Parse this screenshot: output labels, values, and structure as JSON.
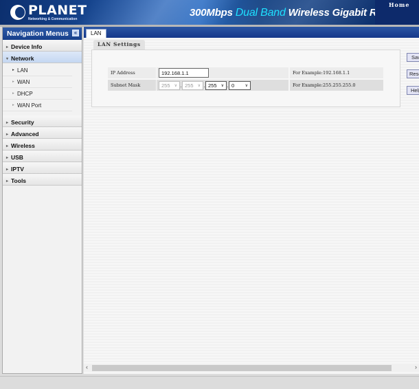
{
  "header": {
    "brand": "PLANET",
    "brand_tagline": "Networking & Communication",
    "product_prefix": "300Mbps ",
    "product_highlight": "Dual Band",
    "product_suffix": " Wireless Gigabit Route",
    "home_link": "Home"
  },
  "nav": {
    "title": "Navigation Menus",
    "collapse_icon": "«",
    "items": [
      {
        "label": "Device Info",
        "expanded": false
      },
      {
        "label": "Network",
        "expanded": true,
        "children": [
          "LAN",
          "WAN",
          "DHCP",
          "WAN Port"
        ]
      },
      {
        "label": "Security",
        "expanded": false
      },
      {
        "label": "Advanced",
        "expanded": false
      },
      {
        "label": "Wireless",
        "expanded": false
      },
      {
        "label": "USB",
        "expanded": false
      },
      {
        "label": "IPTV",
        "expanded": false
      },
      {
        "label": "Tools",
        "expanded": false
      }
    ],
    "current_sub": "LAN"
  },
  "main": {
    "tab": "LAN",
    "section_title": "LAN Settings",
    "form": {
      "ip_address": {
        "label": "IP Address",
        "value": "192.168.1.1",
        "help": "For Example:192.168.1.1"
      },
      "subnet_mask": {
        "label": "Subnet Mask",
        "octets": [
          "255",
          "255",
          "255",
          "0"
        ],
        "disabled": [
          true,
          true,
          false,
          false
        ],
        "help": "For Example:255.255.255.0"
      }
    },
    "buttons": {
      "save": "Save",
      "reset": "Reset",
      "help": "Help"
    }
  },
  "icons": {
    "arrow_right": "▸",
    "arrow_down": "▾",
    "chevron_down": "∨",
    "scroll_left": "‹",
    "scroll_right": "›"
  }
}
